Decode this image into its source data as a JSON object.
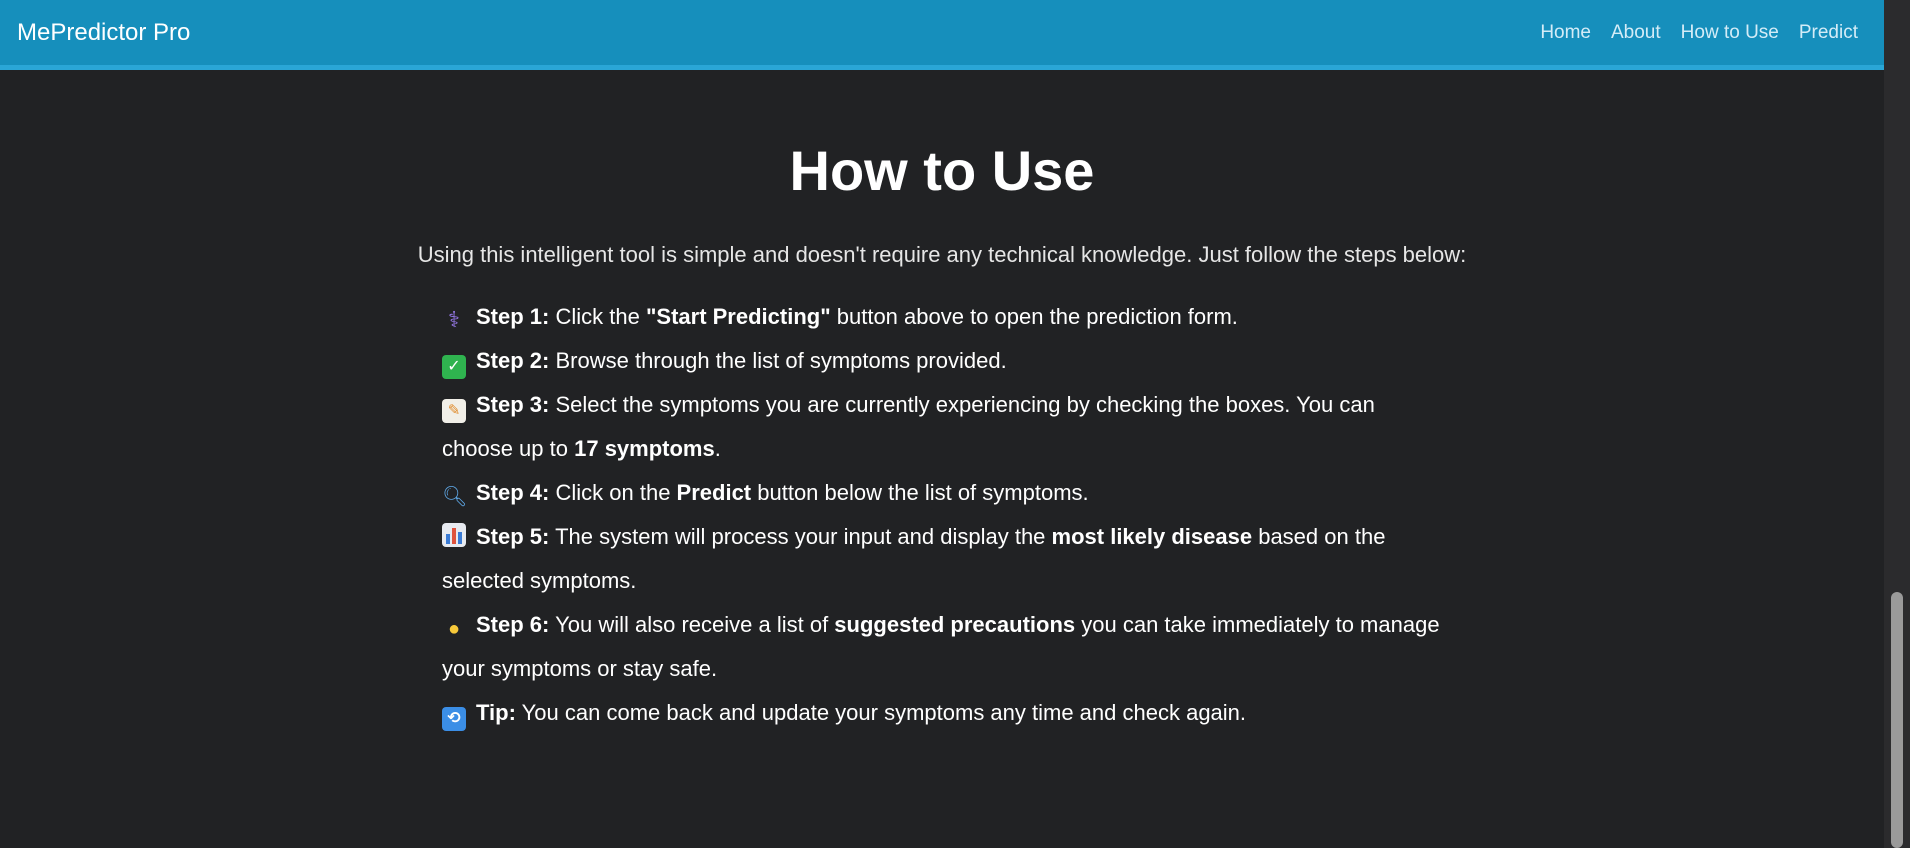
{
  "navbar": {
    "brand": "MePredictor Pro",
    "links": [
      "Home",
      "About",
      "How to Use",
      "Predict"
    ]
  },
  "colors": {
    "navbar": "#168fbc",
    "background": "#212224"
  },
  "page": {
    "title": "How to Use",
    "intro": "Using this intelligent tool is simple and doesn't require any technical knowledge. Just follow the steps below:"
  },
  "steps": [
    {
      "icon": "stethoscope-icon",
      "label": "Step 1:",
      "parts": [
        "Click the ",
        "\"Start Predicting\"",
        " button above to open the prediction form."
      ]
    },
    {
      "icon": "check-mark-icon",
      "label": "Step 2:",
      "parts": [
        "Browse through the list of symptoms provided."
      ]
    },
    {
      "icon": "memo-icon",
      "label": "Step 3:",
      "parts": [
        "Select the symptoms you are currently experiencing by checking the boxes. You can choose up to ",
        "17 symptoms",
        "."
      ]
    },
    {
      "icon": "magnifier-icon",
      "label": "Step 4:",
      "parts": [
        "Click on the ",
        "Predict",
        " button below the list of symptoms."
      ]
    },
    {
      "icon": "bar-chart-icon",
      "label": "Step 5:",
      "parts": [
        "The system will process your input and display the ",
        "most likely disease",
        " based on the selected symptoms."
      ]
    },
    {
      "icon": "light-bulb-icon",
      "label": "Step 6:",
      "parts": [
        "You will also receive a list of ",
        "suggested precautions",
        " you can take immediately to manage your symptoms or stay safe."
      ]
    },
    {
      "icon": "repeat-icon",
      "label": "Tip:",
      "parts": [
        "You can come back and update your symptoms any time and check again."
      ]
    }
  ]
}
